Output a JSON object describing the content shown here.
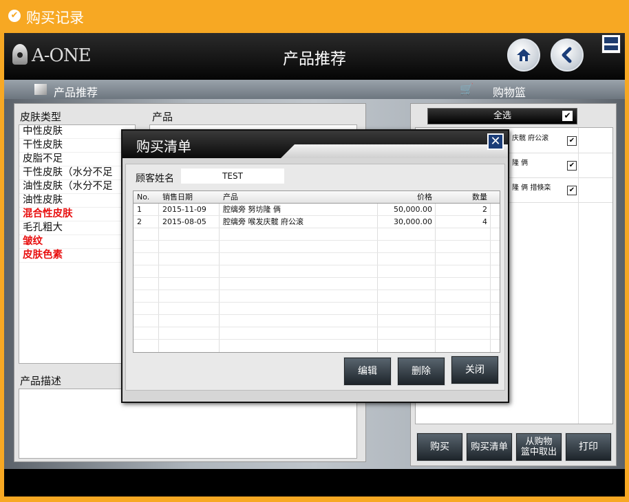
{
  "titlebar": {
    "title": "购买记录",
    "check_icon": "check-circle-icon"
  },
  "header": {
    "logo": "A-ONE",
    "page_title": "产品推荐"
  },
  "section": {
    "left_title": "产品推荐",
    "right_title": "购物篮"
  },
  "left": {
    "skin_type_label": "皮肤类型",
    "product_label": "产品",
    "desc_label": "产品描述",
    "skin_types": [
      {
        "label": "中性皮肤",
        "highlight": false
      },
      {
        "label": "干性皮肤",
        "highlight": false
      },
      {
        "label": "皮脂不足",
        "highlight": false
      },
      {
        "label": "干性皮肤（水分不足",
        "highlight": false
      },
      {
        "label": "油性皮肤（水分不足",
        "highlight": false
      },
      {
        "label": "油性皮肤",
        "highlight": false
      },
      {
        "label": "混合性皮肤",
        "highlight": true
      },
      {
        "label": "毛孔粗大",
        "highlight": false
      },
      {
        "label": "皱纹",
        "highlight": true
      },
      {
        "label": "皮肤色素",
        "highlight": true
      }
    ],
    "highlight_color": "#e81010"
  },
  "cart": {
    "select_all": "全选",
    "items": [
      {
        "name": "庆髋 府公滚",
        "checked": true
      },
      {
        "name": "隆 俩",
        "checked": true
      },
      {
        "name": "隆 俩 措倏栾",
        "checked": true
      }
    ],
    "buttons": {
      "buy": "购买",
      "buy_list": "购买清单",
      "take_out_1": "从购物",
      "take_out_2": "篮中取出",
      "print": "打印"
    }
  },
  "modal": {
    "title": "购买清单",
    "customer_label": "顾客姓名",
    "customer_name": "TEST",
    "columns": {
      "no": "No.",
      "date": "销售日期",
      "product": "产品",
      "price": "价格",
      "qty": "数量"
    },
    "rows": [
      {
        "no": "1",
        "date": "2015-11-09",
        "product": "腔缡旁 努坊隆 俩",
        "price": "50,000.00",
        "qty": "2"
      },
      {
        "no": "2",
        "date": "2015-08-05",
        "product": "腔缡旁 喉发庆髋 府公滚",
        "price": "30,000.00",
        "qty": "4"
      }
    ],
    "buttons": {
      "edit": "编辑",
      "delete": "删除",
      "close": "关闭"
    }
  }
}
